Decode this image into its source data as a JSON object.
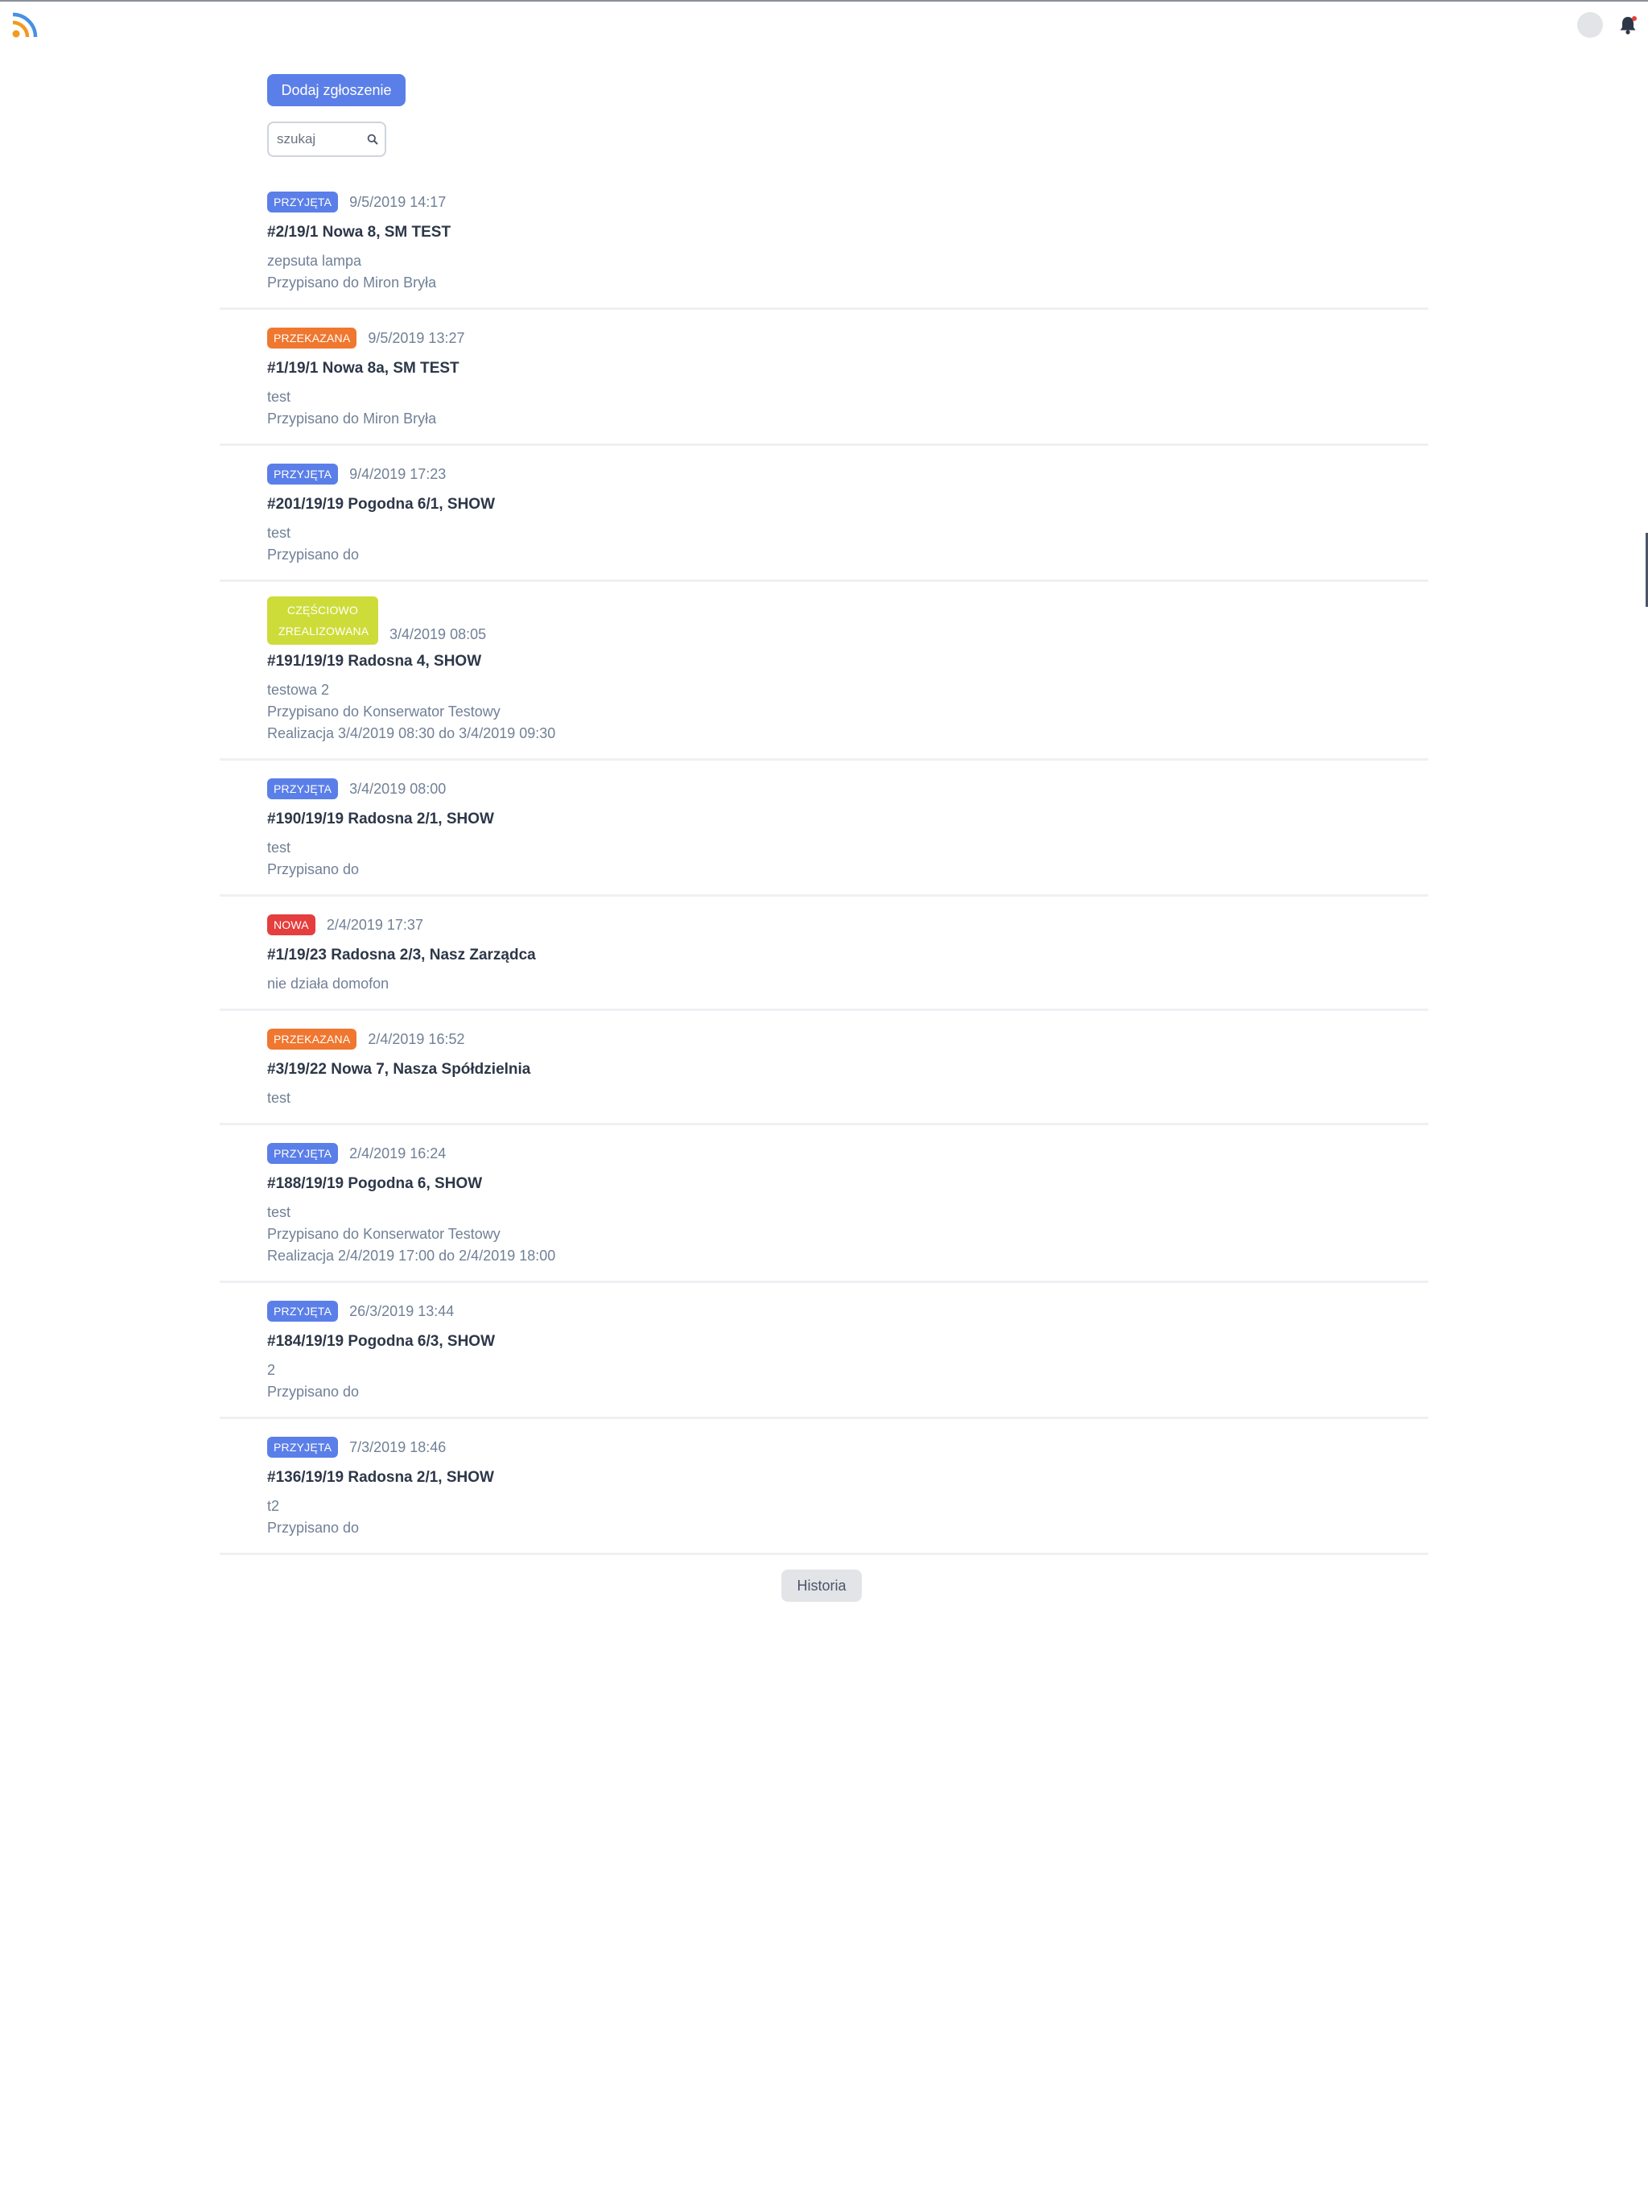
{
  "header": {
    "logo_icon": "rss-icon",
    "avatar": "avatar",
    "bell_icon": "bell-icon"
  },
  "toolbar": {
    "add_label": "Dodaj zgłoszenie",
    "search_placeholder": "szukaj",
    "search_icon": "search-icon"
  },
  "colors": {
    "accent": "#5b7fe8",
    "status_przyjeta": "#5b7fe8",
    "status_przekazana": "#f0772f",
    "status_czesciowo": "#cddc39",
    "status_nowa": "#e53e3e"
  },
  "tickets": [
    {
      "status": "PRZYJĘTA",
      "status_key": "przyjeta",
      "date": "9/5/2019 14:17",
      "title": "#2/19/1 Nowa 8, SM TEST",
      "lines": [
        "zepsuta lampa",
        "Przypisano do Miron Bryła"
      ]
    },
    {
      "status": "PRZEKAZANA",
      "status_key": "przekazana",
      "date": "9/5/2019 13:27",
      "title": "#1/19/1 Nowa 8a, SM TEST",
      "lines": [
        "test",
        "Przypisano do Miron Bryła"
      ]
    },
    {
      "status": "PRZYJĘTA",
      "status_key": "przyjeta",
      "date": "9/4/2019 17:23",
      "title": "#201/19/19 Pogodna 6/1, SHOW",
      "lines": [
        "test",
        "Przypisano do"
      ]
    },
    {
      "status": "CZĘŚCIOWO ZREALIZOWANA",
      "status_key": "czesciowo",
      "date": "3/4/2019 08:05",
      "title": "#191/19/19 Radosna 4, SHOW",
      "lines": [
        "testowa 2",
        "Przypisano do Konserwator Testowy",
        "Realizacja 3/4/2019 08:30 do 3/4/2019 09:30"
      ]
    },
    {
      "status": "PRZYJĘTA",
      "status_key": "przyjeta",
      "date": "3/4/2019 08:00",
      "title": "#190/19/19 Radosna 2/1, SHOW",
      "lines": [
        "test",
        "Przypisano do"
      ]
    },
    {
      "status": "NOWA",
      "status_key": "nowa",
      "date": "2/4/2019 17:37",
      "title": "#1/19/23 Radosna 2/3, Nasz Zarządca",
      "lines": [
        "nie działa domofon"
      ]
    },
    {
      "status": "PRZEKAZANA",
      "status_key": "przekazana",
      "date": "2/4/2019 16:52",
      "title": "#3/19/22 Nowa 7, Nasza Spółdzielnia",
      "lines": [
        "test"
      ]
    },
    {
      "status": "PRZYJĘTA",
      "status_key": "przyjeta",
      "date": "2/4/2019 16:24",
      "title": "#188/19/19 Pogodna 6, SHOW",
      "lines": [
        "test",
        "Przypisano do Konserwator Testowy",
        "Realizacja 2/4/2019 17:00 do 2/4/2019 18:00"
      ]
    },
    {
      "status": "PRZYJĘTA",
      "status_key": "przyjeta",
      "date": "26/3/2019 13:44",
      "title": "#184/19/19 Pogodna 6/3, SHOW",
      "lines": [
        "2",
        "Przypisano do"
      ]
    },
    {
      "status": "PRZYJĘTA",
      "status_key": "przyjeta",
      "date": "7/3/2019 18:46",
      "title": "#136/19/19 Radosna 2/1, SHOW",
      "lines": [
        "t2",
        "Przypisano do"
      ]
    }
  ],
  "footer": {
    "history_label": "Historia"
  }
}
